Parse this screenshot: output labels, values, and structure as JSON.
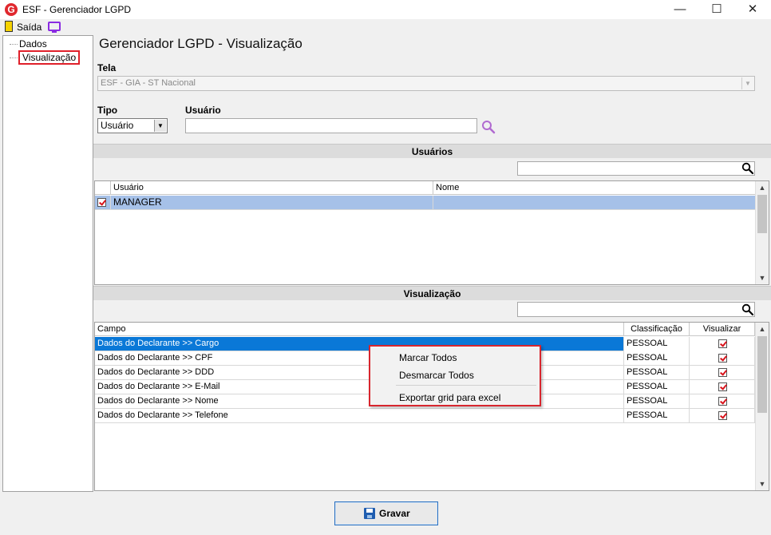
{
  "window": {
    "title": "ESF - Gerenciador LGPD",
    "icon_letter": "G",
    "minimize_glyph": "—",
    "maximize_glyph": "☐",
    "close_glyph": "✕"
  },
  "menubar": {
    "exit_label": "Saída",
    "icons": [
      "exit-door-icon",
      "monitor-icon"
    ]
  },
  "tree": {
    "items": [
      {
        "label": "Dados",
        "selected": false
      },
      {
        "label": "Visualização",
        "selected": true
      }
    ]
  },
  "page": {
    "title": "Gerenciador LGPD - Visualização"
  },
  "tela": {
    "label": "Tela",
    "value": "ESF - GIA - ST Nacional",
    "arrow": "▼"
  },
  "tipo": {
    "label": "Tipo",
    "value": "Usuário",
    "arrow": "▼"
  },
  "usuario_field": {
    "label": "Usuário",
    "value": ""
  },
  "usuarios_section": {
    "header": "Usuários",
    "search_value": "",
    "columns": [
      "Usuário",
      "Nome"
    ],
    "rows": [
      {
        "checked": true,
        "usuario": "MANAGER",
        "nome": ""
      }
    ],
    "selected_row_color": "#a6c1e8"
  },
  "visualizacao_section": {
    "header": "Visualização",
    "search_value": "",
    "columns": [
      "Campo",
      "Classificação",
      "Visualizar"
    ],
    "rows": [
      {
        "campo": "Dados do Declarante >> Cargo",
        "classificacao": "PESSOAL",
        "visualizar": true,
        "selected": true
      },
      {
        "campo": "Dados do Declarante >> CPF",
        "classificacao": "PESSOAL",
        "visualizar": true,
        "selected": false
      },
      {
        "campo": "Dados do Declarante >> DDD",
        "classificacao": "PESSOAL",
        "visualizar": true,
        "selected": false
      },
      {
        "campo": "Dados do Declarante >> E-Mail",
        "classificacao": "PESSOAL",
        "visualizar": true,
        "selected": false
      },
      {
        "campo": "Dados do Declarante >> Nome",
        "classificacao": "PESSOAL",
        "visualizar": true,
        "selected": false
      },
      {
        "campo": "Dados do Declarante >> Telefone",
        "classificacao": "PESSOAL",
        "visualizar": true,
        "selected": false
      }
    ],
    "selected_row_color": "#0a78d7"
  },
  "context_menu": {
    "items": [
      "Marcar Todos",
      "Desmarcar Todos",
      "Exportar grid para excel"
    ]
  },
  "scroll": {
    "up": "▲",
    "down": "▼"
  },
  "save_button": {
    "label": "Gravar"
  },
  "colors": {
    "highlight_red": "#d8262e",
    "accent_purple": "#8a2be2"
  }
}
